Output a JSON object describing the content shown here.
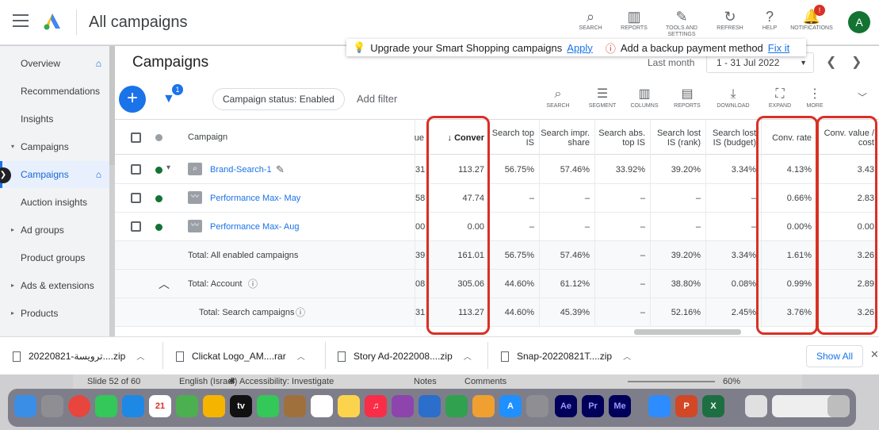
{
  "header": {
    "title": "All campaigns",
    "tools": [
      {
        "icon": "search-icon",
        "glyph": "⌕",
        "label": "SEARCH"
      },
      {
        "icon": "reports-icon",
        "glyph": "▥",
        "label": "REPORTS"
      },
      {
        "icon": "tools-icon",
        "glyph": "✎",
        "label": "TOOLS AND SETTINGS"
      },
      {
        "icon": "refresh-icon",
        "glyph": "↻",
        "label": "REFRESH"
      },
      {
        "icon": "help-icon",
        "glyph": "?",
        "label": "HELP"
      },
      {
        "icon": "bell-icon",
        "glyph": "🔔",
        "label": "NOTIFICATIONS"
      }
    ],
    "notification_count": "!",
    "avatar": "A"
  },
  "alert": {
    "upgrade_text": "Upgrade your Smart Shopping campaigns",
    "upgrade_link": "Apply",
    "payment_text": "Add a backup payment method",
    "payment_link": "Fix it"
  },
  "nav": [
    {
      "label": "Overview",
      "caret": "",
      "home": "⌂",
      "active": false
    },
    {
      "label": "Recommendations",
      "caret": "",
      "home": "",
      "active": false
    },
    {
      "label": "Insights",
      "caret": "",
      "home": "",
      "active": false
    },
    {
      "label": "Campaigns",
      "caret": "▾",
      "home": "",
      "active": false
    },
    {
      "label": "Campaigns",
      "caret": "",
      "home": "⌂",
      "active": true
    },
    {
      "label": "Auction insights",
      "caret": "",
      "home": "",
      "active": false
    },
    {
      "label": "Ad groups",
      "caret": "▸",
      "home": "",
      "active": false
    },
    {
      "label": "Product groups",
      "caret": "",
      "home": "",
      "active": false
    },
    {
      "label": "Ads & extensions",
      "caret": "▸",
      "home": "",
      "active": false
    },
    {
      "label": "Products",
      "caret": "▸",
      "home": "",
      "active": false
    }
  ],
  "main": {
    "title": "Campaigns",
    "date_label": "Last month",
    "date_range": "1 - 31 Jul 2022",
    "filter_count": "1",
    "status_chip": "Campaign status: Enabled",
    "add_filter": "Add filter",
    "toolbar": [
      {
        "label": "SEARCH",
        "glyph": "⌕",
        "icon": "search-icon"
      },
      {
        "label": "SEGMENT",
        "glyph": "☰",
        "icon": "segment-icon"
      },
      {
        "label": "COLUMNS",
        "glyph": "▥",
        "icon": "columns-icon"
      },
      {
        "label": "REPORTS",
        "glyph": "▤",
        "icon": "reports-icon"
      },
      {
        "label": "DOWNLOAD",
        "glyph": "⤓",
        "icon": "download-icon"
      },
      {
        "label": "EXPAND",
        "glyph": "⛶",
        "icon": "expand-icon"
      },
      {
        "label": "MORE",
        "glyph": "⋮",
        "icon": "more-icon"
      }
    ]
  },
  "table": {
    "headers": [
      "Campaign",
      "ue",
      "↓ Conver",
      "Search top IS",
      "Search impr. share",
      "Search abs. top IS",
      "Search lost IS (rank)",
      "Search lost IS (budget)",
      "Conv. rate",
      "Conv. value / cost"
    ],
    "rows": [
      {
        "name": "Brand-Search-1",
        "type": "campaign",
        "icon": "search-campaign-icon",
        "values": [
          "31",
          "113.27",
          "56.75%",
          "57.46%",
          "33.92%",
          "39.20%",
          "3.34%",
          "4.13%",
          "3.43"
        ]
      },
      {
        "name": "Performance Max- May",
        "type": "campaign",
        "icon": "performance-max-icon",
        "values": [
          "58",
          "47.74",
          "–",
          "–",
          "–",
          "–",
          "–",
          "0.66%",
          "2.83"
        ]
      },
      {
        "name": "Performance Max- Aug",
        "type": "campaign",
        "icon": "performance-max-icon",
        "values": [
          "00",
          "0.00",
          "–",
          "–",
          "–",
          "–",
          "–",
          "0.00%",
          "0.00"
        ]
      },
      {
        "name": "Total: All enabled campaigns",
        "type": "total",
        "values": [
          "39",
          "161.01",
          "56.75%",
          "57.46%",
          "–",
          "39.20%",
          "3.34%",
          "1.61%",
          "3.26"
        ]
      },
      {
        "name": "Total: Account",
        "type": "total",
        "values": [
          "08",
          "305.06",
          "44.60%",
          "61.12%",
          "–",
          "38.80%",
          "0.08%",
          "0.99%",
          "2.89"
        ]
      },
      {
        "name": "Total: Search campaigns",
        "type": "total",
        "values": [
          "31",
          "113.27",
          "44.60%",
          "45.39%",
          "–",
          "52.16%",
          "2.45%",
          "3.76%",
          "3.26"
        ]
      }
    ]
  },
  "downloads": {
    "items": [
      "20220821-ترويسة....zip",
      "Clickat Logo_AM....rar",
      "Story Ad-2022008....zip",
      "Snap-20220821T....zip"
    ],
    "show_all": "Show All"
  },
  "statusbar": {
    "slide": "Slide 52 of 60",
    "language": "English (Israel)",
    "accessibility": "Accessibility: Investigate",
    "notes": "Notes",
    "comments": "Comments",
    "zoom": "60%"
  },
  "colors": {
    "accent": "#1a73e8",
    "highlight": "#d93025",
    "enabled": "#137333"
  }
}
